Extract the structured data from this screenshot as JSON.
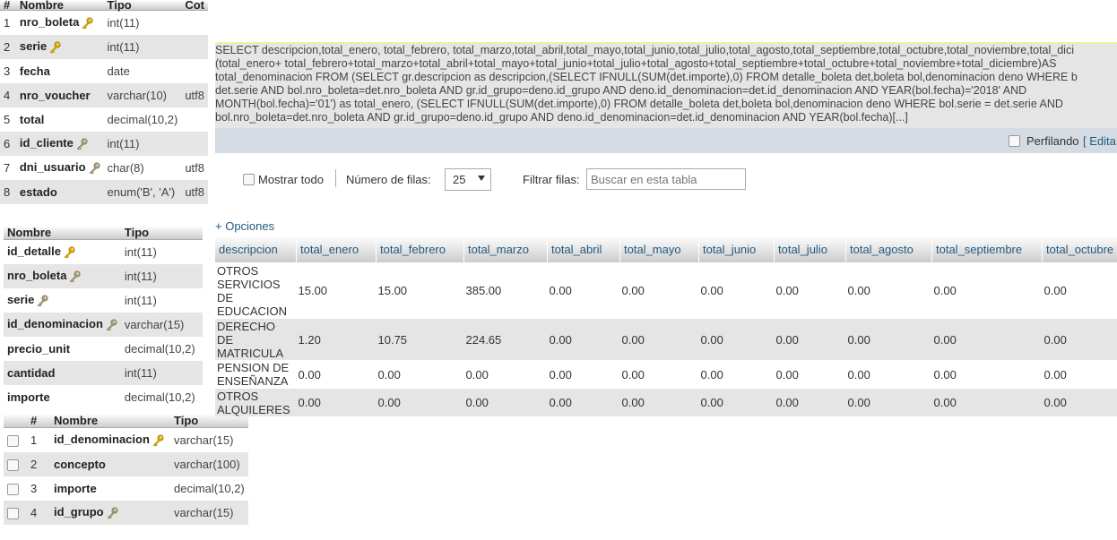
{
  "boleta_table": {
    "headers": [
      "#",
      "Nombre",
      "Tipo",
      "Cot"
    ],
    "rows": [
      {
        "num": "1",
        "name": "nro_boleta",
        "type": "int(11)",
        "extra": "",
        "key": "primary"
      },
      {
        "num": "2",
        "name": "serie",
        "type": "int(11)",
        "extra": "",
        "key": "primary"
      },
      {
        "num": "3",
        "name": "fecha",
        "type": "date",
        "extra": "",
        "key": ""
      },
      {
        "num": "4",
        "name": "nro_voucher",
        "type": "varchar(10)",
        "extra": "utf8",
        "key": ""
      },
      {
        "num": "5",
        "name": "total",
        "type": "decimal(10,2)",
        "extra": "",
        "key": ""
      },
      {
        "num": "6",
        "name": "id_cliente",
        "type": "int(11)",
        "extra": "",
        "key": "index"
      },
      {
        "num": "7",
        "name": "dni_usuario",
        "type": "char(8)",
        "extra": "utf8",
        "key": "index"
      },
      {
        "num": "8",
        "name": "estado",
        "type": "enum('B', 'A')",
        "extra": "utf8",
        "key": ""
      }
    ]
  },
  "detalle_table": {
    "headers": [
      "Nombre",
      "Tipo"
    ],
    "rows": [
      {
        "name": "id_detalle",
        "type": "int(11)",
        "key": "primary"
      },
      {
        "name": "nro_boleta",
        "type": "int(11)",
        "key": "index"
      },
      {
        "name": "serie",
        "type": "int(11)",
        "key": "index"
      },
      {
        "name": "id_denominacion",
        "type": "varchar(15)",
        "key": "index"
      },
      {
        "name": "precio_unit",
        "type": "decimal(10,2)",
        "key": ""
      },
      {
        "name": "cantidad",
        "type": "int(11)",
        "key": ""
      },
      {
        "name": "importe",
        "type": "decimal(10,2)",
        "key": ""
      }
    ]
  },
  "denominacion_table": {
    "headers": [
      "#",
      "Nombre",
      "Tipo"
    ],
    "rows": [
      {
        "num": "1",
        "name": "id_denominacion",
        "type": "varchar(15)",
        "key": "primary"
      },
      {
        "num": "2",
        "name": "concepto",
        "type": "varchar(100)",
        "key": ""
      },
      {
        "num": "3",
        "name": "importe",
        "type": "decimal(10,2)",
        "key": ""
      },
      {
        "num": "4",
        "name": "id_grupo",
        "type": "varchar(15)",
        "key": "index"
      }
    ]
  },
  "sql": {
    "lines": [
      "SELECT descripcion,total_enero, total_febrero, total_marzo,total_abril,total_mayo,total_junio,total_julio,total_agosto,total_septiembre,total_octubre,total_noviembre,total_dici",
      "(total_enero+ total_febrero+total_marzo+total_abril+total_mayo+total_junio+total_julio+total_agosto+total_septiembre+total_octubre+total_noviembre+total_diciembre)AS",
      "total_denominacion FROM (SELECT gr.descripcion as descripcion,(SELECT IFNULL(SUM(det.importe),0) FROM detalle_boleta det,boleta bol,denominacion deno WHERE b",
      "det.serie AND bol.nro_boleta=det.nro_boleta AND gr.id_grupo=deno.id_grupo AND deno.id_denominacion=det.id_denominacion AND YEAR(bol.fecha)='2018' AND",
      "MONTH(bol.fecha)='01') as total_enero, (SELECT IFNULL(SUM(det.importe),0) FROM detalle_boleta det,boleta bol,denominacion deno WHERE bol.serie = det.serie AND",
      "bol.nro_boleta=det.nro_boleta AND gr.id_grupo=deno.id_grupo AND deno.id_denominacion=det.id_denominacion AND YEAR(bol.fecha)[...]"
    ],
    "profiling_label": "Perfilando",
    "edit_label": "[ Edita"
  },
  "controls": {
    "show_all_label": "Mostrar todo",
    "rows_label": "Número de filas:",
    "rows_value": "25",
    "filter_label": "Filtrar filas:",
    "filter_placeholder": "Buscar en esta tabla",
    "options_label": "+ Opciones"
  },
  "results": {
    "columns": [
      "descripcion",
      "total_enero",
      "total_febrero",
      "total_marzo",
      "total_abril",
      "total_mayo",
      "total_junio",
      "total_julio",
      "total_agosto",
      "total_septiembre",
      "total_octubre"
    ],
    "rows": [
      {
        "desc": [
          "OTROS",
          "SERVICIOS",
          "DE",
          "EDUCACION"
        ],
        "values": [
          "15.00",
          "15.00",
          "385.00",
          "0.00",
          "0.00",
          "0.00",
          "0.00",
          "0.00",
          "0.00",
          "0.00"
        ]
      },
      {
        "desc": [
          "DERECHO",
          "DE",
          "MATRICULA"
        ],
        "values": [
          "1.20",
          "10.75",
          "224.65",
          "0.00",
          "0.00",
          "0.00",
          "0.00",
          "0.00",
          "0.00",
          "0.00"
        ]
      },
      {
        "desc": [
          "PENSION DE",
          "ENSEÑANZA"
        ],
        "values": [
          "0.00",
          "0.00",
          "0.00",
          "0.00",
          "0.00",
          "0.00",
          "0.00",
          "0.00",
          "0.00",
          "0.00"
        ]
      },
      {
        "desc": [
          "OTROS",
          "ALQUILERES"
        ],
        "values": [
          "0.00",
          "0.00",
          "0.00",
          "0.00",
          "0.00",
          "0.00",
          "0.00",
          "0.00",
          "0.00",
          "0.00"
        ]
      }
    ]
  },
  "colors": {
    "link": "#235a81",
    "key_primary": "#e0b000",
    "key_index": "#a0a0a0"
  }
}
